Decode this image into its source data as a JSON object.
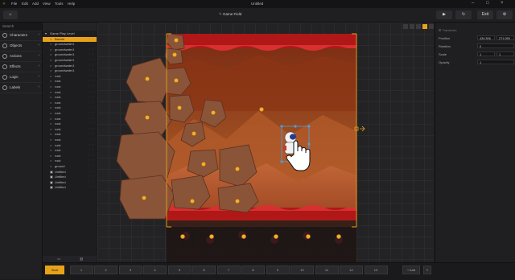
{
  "menubar": {
    "items": [
      "File",
      "Edit",
      "Add",
      "View",
      "Tools",
      "Help"
    ],
    "app_title": "Untitled"
  },
  "toolbar": {
    "scene_name": "Game Field",
    "exit_label": "Exit"
  },
  "sidebar": {
    "search_placeholder": "Search",
    "items": [
      {
        "label": "Characters"
      },
      {
        "label": "Objects"
      },
      {
        "label": "Actions"
      },
      {
        "label": "Effects"
      },
      {
        "label": "Logic"
      },
      {
        "label": "Labels"
      }
    ]
  },
  "hierarchy": {
    "items": [
      "Game Play Level",
      "Bacnie",
      "groundwater1",
      "groundwater1",
      "groundwater1",
      "groundwater1",
      "groundwater1",
      "groundwater1",
      "rock",
      "rock",
      "rock",
      "rock",
      "rock",
      "rock",
      "rock",
      "rock",
      "rock",
      "rock",
      "rock",
      "rock",
      "rock",
      "rock",
      "rock",
      "rock",
      "rock",
      "ground",
      "Untitled",
      "Untitled",
      "Untitled",
      "Untitled"
    ],
    "selected_index": 1
  },
  "properties": {
    "section": "Transform",
    "position_label": "Position",
    "position_x": "434.306",
    "position_y": "271.059",
    "rotation_label": "Rotation",
    "rotation": "0",
    "scale_label": "Scale",
    "scale_x": "1",
    "scale_y": "1",
    "opacity_label": "Opacity",
    "opacity": "1"
  },
  "timeline": {
    "scenes": [
      "Start",
      "1",
      "2",
      "3",
      "4",
      "5",
      "6",
      "7",
      "8",
      "9",
      "10",
      "11",
      "12",
      "13"
    ],
    "add_label": "+ Add"
  },
  "colors": {
    "accent": "#e8a21a",
    "lava": "#c41c1c",
    "sky": "#8a3a16"
  }
}
